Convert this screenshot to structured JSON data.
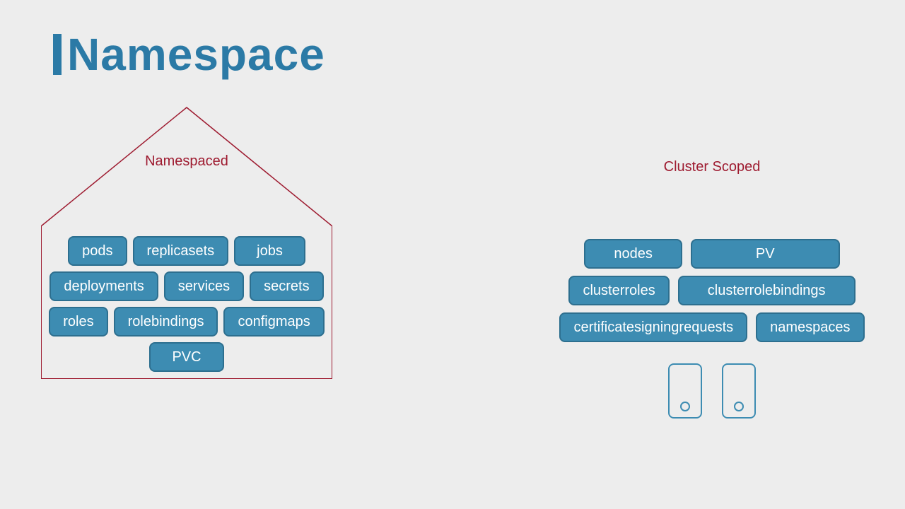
{
  "title": "Namespace",
  "namespaced": {
    "label": "Namespaced",
    "items": [
      "pods",
      "replicasets",
      "jobs",
      "deployments",
      "services",
      "secrets",
      "roles",
      "rolebindings",
      "configmaps",
      "PVC"
    ]
  },
  "cluster": {
    "label": "Cluster Scoped",
    "row1": [
      "nodes",
      "PV"
    ],
    "row2": [
      "clusterroles",
      "clusterrolebindings"
    ],
    "row3": [
      "certificatesigningrequests",
      "namespaces"
    ]
  }
}
